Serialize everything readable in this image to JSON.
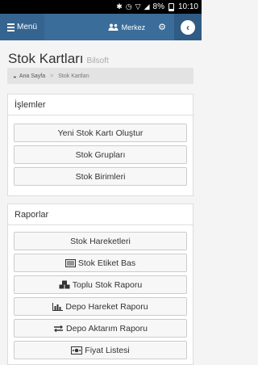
{
  "status_bar": {
    "battery": "8%",
    "time": "10:10",
    "icons": [
      "bluetooth-icon",
      "alarm-icon",
      "wifi-icon",
      "signal-icon",
      "battery-icon"
    ]
  },
  "navbar": {
    "menu_label": "Menü",
    "location_label": "Merkez",
    "menu_icon": "hamburger-icon",
    "location_icon": "users-icon",
    "settings_icon": "cogs-icon",
    "back_icon": "chevron-left-icon"
  },
  "page": {
    "title": "Stok Kartları",
    "subtitle": "Bilsoft"
  },
  "breadcrumb": {
    "home": "Ana Sayfa",
    "separator": ">",
    "current": "Stok Kartları"
  },
  "islemler": {
    "heading": "İşlemler",
    "buttons": [
      {
        "label": "Yeni Stok Kartı Oluştur"
      },
      {
        "label": "Stok Grupları"
      },
      {
        "label": "Stok Birimleri"
      }
    ]
  },
  "raporlar": {
    "heading": "Raporlar",
    "buttons": [
      {
        "label": "Stok Hareketleri",
        "icon": ""
      },
      {
        "label": "Stok Etiket Bas",
        "icon": "barcode-list-icon"
      },
      {
        "label": "Toplu Stok Raporu",
        "icon": "cubes-icon"
      },
      {
        "label": "Depo Hareket Raporu",
        "icon": "bar-chart-icon"
      },
      {
        "label": "Depo Aktarım Raporu",
        "icon": "exchange-icon"
      },
      {
        "label": "Fiyat Listesi",
        "icon": "money-icon"
      }
    ]
  },
  "colors": {
    "navbar": "#3a6d9a",
    "menu_button": "#356490",
    "back_button": "#2f5b84",
    "page_background": "#f4f4f4"
  }
}
